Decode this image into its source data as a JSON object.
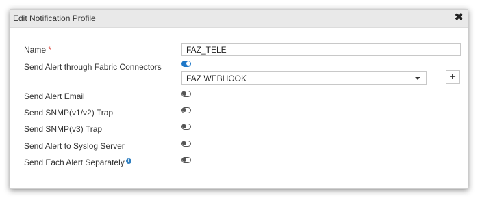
{
  "dialog": {
    "title": "Edit Notification Profile",
    "close_label": "✖"
  },
  "form": {
    "name": {
      "label": "Name",
      "required_mark": "*",
      "value": "FAZ_TELE"
    },
    "fabric_connectors": {
      "label": "Send Alert through Fabric Connectors",
      "enabled": true,
      "selected_connector": "FAZ WEBHOOK",
      "add_label": "+"
    },
    "alert_email": {
      "label": "Send Alert Email",
      "enabled": false
    },
    "snmp_v1v2": {
      "label": "Send SNMP(v1/v2) Trap",
      "enabled": false
    },
    "snmp_v3": {
      "label": "Send SNMP(v3) Trap",
      "enabled": false
    },
    "syslog": {
      "label": "Send Alert to Syslog Server",
      "enabled": false
    },
    "separately": {
      "label": "Send Each Alert Separately",
      "info_icon": "i",
      "enabled": false
    }
  },
  "colors": {
    "accent": "#1f78c8",
    "required": "#d9342b",
    "info": "#2f7fc1"
  }
}
